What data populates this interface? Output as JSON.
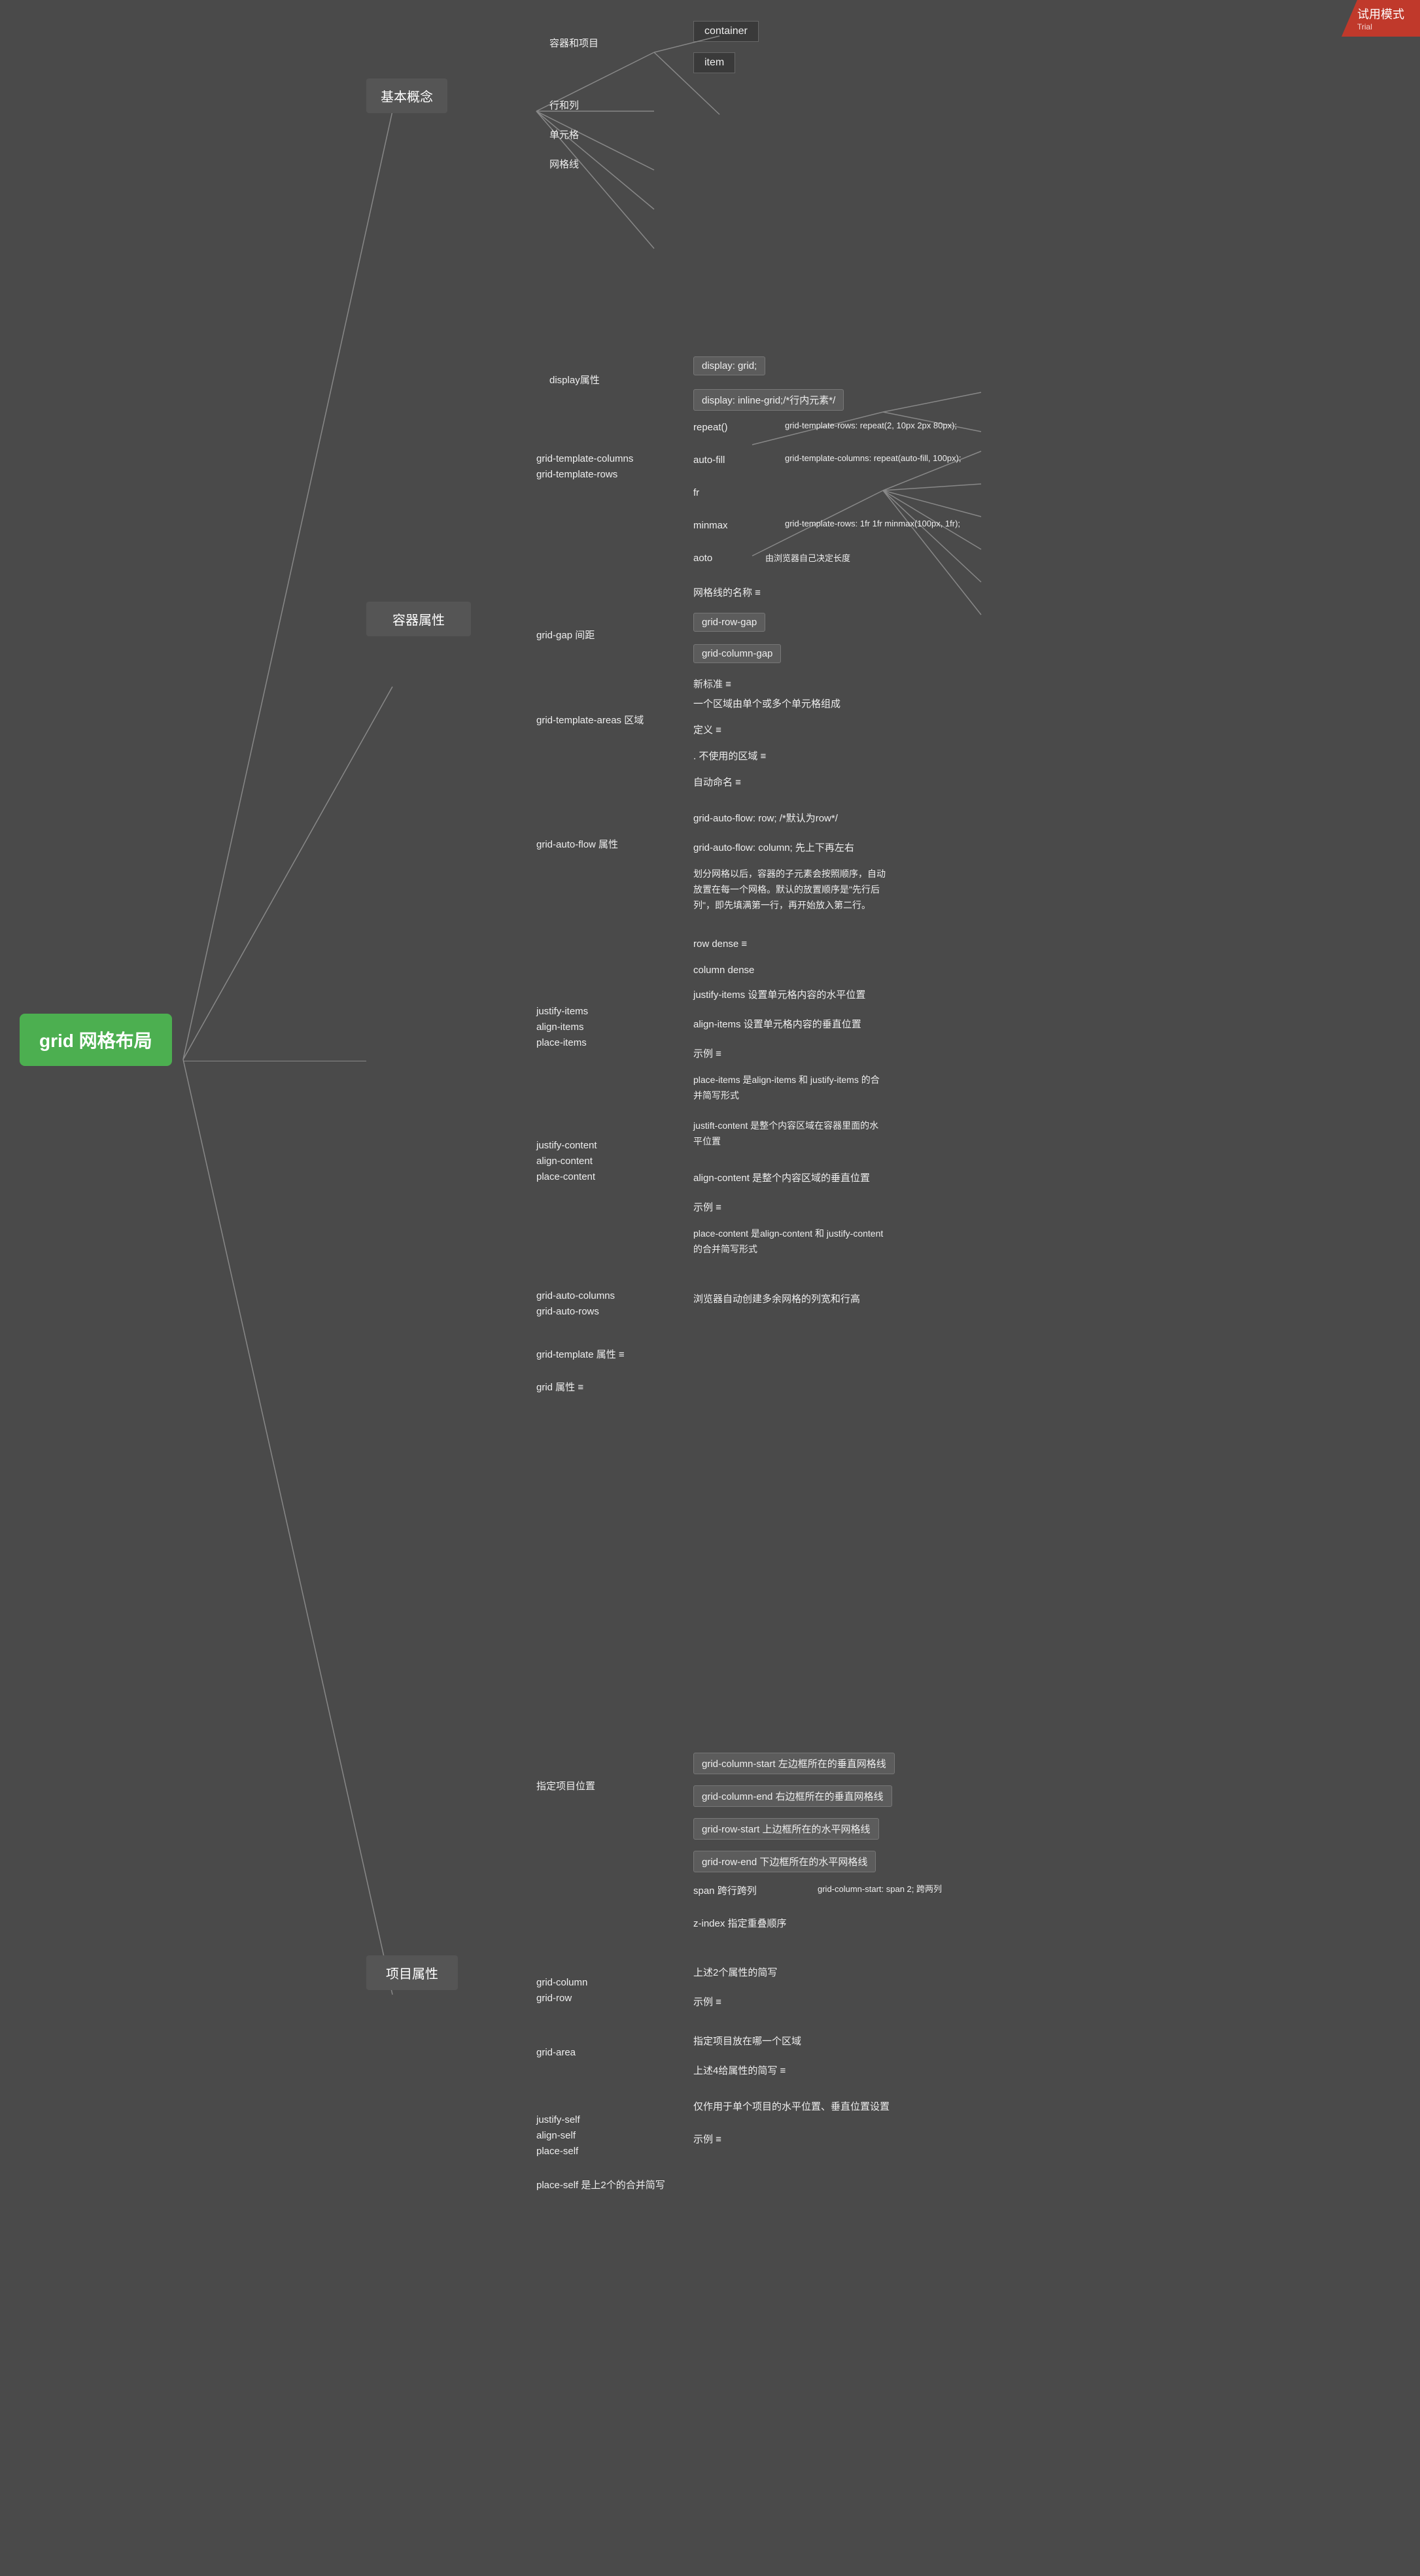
{
  "trial_badge": {
    "main": "试用模式",
    "sub": "Trial"
  },
  "center": {
    "label": "grid 网格布局"
  },
  "branches": {
    "basic": {
      "label": "基本概念",
      "children": [
        {
          "label": "容器和项目",
          "children": [
            "container",
            "item"
          ]
        },
        {
          "label": "行和列"
        },
        {
          "label": "单元格"
        },
        {
          "label": "网格线"
        }
      ]
    },
    "container": {
      "label": "容器属性",
      "children": [
        {
          "label": "display属性",
          "children": [
            {
              "label": "display: grid;"
            },
            {
              "label": "display: inline-grid;/*行内元素*/"
            }
          ]
        },
        {
          "label": "grid-template-columns\ngrid-template-rows",
          "children": [
            {
              "label": "repeat()",
              "detail": "grid-template-rows: repeat(2, 10px 2px 80px);"
            },
            {
              "label": "auto-fill",
              "detail": "grid-template-columns: repeat(auto-fill, 100px);"
            },
            {
              "label": "fr"
            },
            {
              "label": "minmax",
              "detail": "grid-template-rows: 1fr 1fr minmax(100px, 1fr);"
            },
            {
              "label": "aoto",
              "detail": "由浏览器自己决定长度"
            },
            {
              "label": "网格线的名称 ≡"
            }
          ]
        },
        {
          "label": "grid-gap 间距",
          "children": [
            {
              "label": "grid-row-gap"
            },
            {
              "label": "grid-column-gap"
            },
            {
              "label": "新标准 ≡"
            }
          ]
        },
        {
          "label": "grid-template-areas 区域",
          "children": [
            {
              "label": "一个区域由单个或多个单元格组成"
            },
            {
              "label": "定义 ≡"
            },
            {
              "label": ". 不使用的区域 ≡"
            },
            {
              "label": "自动命名 ≡"
            }
          ]
        },
        {
          "label": "grid-auto-flow 属性",
          "children": [
            {
              "label": "grid-auto-flow: row; /*默认为row*/"
            },
            {
              "label": "grid-auto-flow: column;      先上下再左右"
            },
            {
              "label": "划分网格以后，容器的子元素会按照顺序，自动放置在每一个网格。默认的放置顺序是\"先行后列\"，即先填满第一行，再开始放入第二行。"
            },
            {
              "label": "row dense ≡"
            },
            {
              "label": "column dense"
            }
          ]
        },
        {
          "label": "justify-items\nalign-items\nplace-items",
          "children": [
            {
              "label": "justify-items 设置单元格内容的水平位置"
            },
            {
              "label": "align-items 设置单元格内容的垂直位置"
            },
            {
              "label": "示例 ≡"
            },
            {
              "label": "place-items 是align-items 和 justify-items 的合并简写形式"
            }
          ]
        },
        {
          "label": "justify-content\nalign-content\nplace-content",
          "children": [
            {
              "label": "justift-content 是整个内容区域在容器里面的水平位置"
            },
            {
              "label": "align-content 是整个内容区域的垂直位置"
            },
            {
              "label": "示例 ≡"
            },
            {
              "label": "place-content 是align-content 和 justify-content 的合并简写形式"
            }
          ]
        },
        {
          "label": "grid-auto-columns\ngrid-auto-rows",
          "detail": "浏览器自动创建多余网格的列宽和行高"
        },
        {
          "label": "grid-template 属性 ≡"
        },
        {
          "label": "grid 属性 ≡"
        }
      ]
    },
    "item": {
      "label": "项目属性",
      "children": [
        {
          "label": "指定项目位置",
          "children": [
            {
              "label": "grid-column-start 左边框所在的垂直网格线"
            },
            {
              "label": "grid-column-end 右边框所在的垂直网格线"
            },
            {
              "label": "grid-row-start 上边框所在的水平网格线"
            },
            {
              "label": "grid-row-end 下边框所在的水平网格线"
            },
            {
              "label": "span 跨行跨列",
              "detail": "grid-column-start: span 2; 跨两列"
            },
            {
              "label": "z-index 指定重叠顺序"
            }
          ]
        },
        {
          "label": "grid-column\ngrid-row",
          "children": [
            {
              "label": "上述2个属性的简写"
            },
            {
              "label": "示例 ≡"
            }
          ]
        },
        {
          "label": "grid-area",
          "children": [
            {
              "label": "指定项目放在哪一个区域"
            },
            {
              "label": "上述4给属性的简写 ≡"
            }
          ]
        },
        {
          "label": "justify-self\nalign-self\nplace-self",
          "children": [
            {
              "label": "仅作用于单个项目的水平位置、垂直位置设置"
            },
            {
              "label": "示例 ≡"
            }
          ]
        },
        {
          "label": "place-self 是上2个的合并简写"
        }
      ]
    }
  }
}
